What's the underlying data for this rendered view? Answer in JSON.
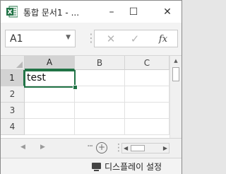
{
  "window": {
    "title": "통합 문서1 - ...",
    "minimize": "–",
    "maximize": "☐",
    "close": "✕"
  },
  "formula_bar": {
    "name_box": "A1",
    "name_dropdown": "▼",
    "separator": "⋮",
    "cancel": "✕",
    "enter": "✓",
    "function": "fx"
  },
  "grid": {
    "columns": [
      "A",
      "B",
      "C"
    ],
    "rows": [
      "1",
      "2",
      "3",
      "4"
    ],
    "cells": {
      "A1": "test"
    }
  },
  "sheet_bar": {
    "prev": "◀",
    "next": "▶",
    "dots": "···",
    "add_sheet": "+",
    "separator": "⋮",
    "hs_left": "◀",
    "hs_right": "▶"
  },
  "status_bar": {
    "display_settings": "디스플레이 설정"
  },
  "colors": {
    "accent": "#217346"
  },
  "icons": {
    "app": "excel-icon",
    "display": "display-icon"
  }
}
